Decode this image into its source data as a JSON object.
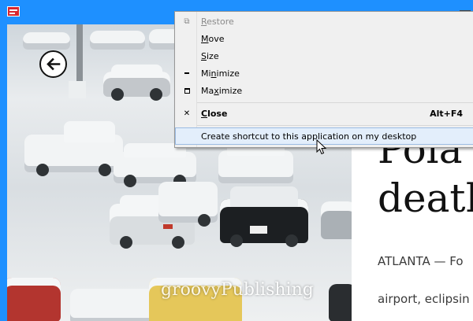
{
  "window": {
    "app_icon": "app-window-icon",
    "frame_color": "#1e90ff"
  },
  "back_button": {
    "icon": "back-arrow-icon"
  },
  "system_menu": {
    "items": [
      {
        "label": "Restore",
        "mnemonic": "R",
        "rest": "estore",
        "icon": "restore-icon",
        "disabled": true
      },
      {
        "label": "Move",
        "mnemonic": "M",
        "rest": "ove"
      },
      {
        "label": "Size",
        "mnemonic": "S",
        "rest": "ize"
      },
      {
        "label": "Minimize",
        "pre": "Mi",
        "mnemonic": "n",
        "rest": "imize",
        "icon": "minimize-icon"
      },
      {
        "label": "Maximize",
        "pre": "Ma",
        "mnemonic": "x",
        "rest": "imize",
        "icon": "maximize-icon"
      },
      {
        "label": "Close",
        "mnemonic": "C",
        "rest": "lose",
        "icon": "close-icon",
        "shortcut": "Alt+F4"
      },
      {
        "label": "Create shortcut to this application on my desktop"
      }
    ]
  },
  "article": {
    "headline_line1": "Pola",
    "headline_line2": "death",
    "dateline": "ATLANTA — Fo",
    "body_line": "airport, eclipsin"
  },
  "watermark": "groovyPublishing"
}
